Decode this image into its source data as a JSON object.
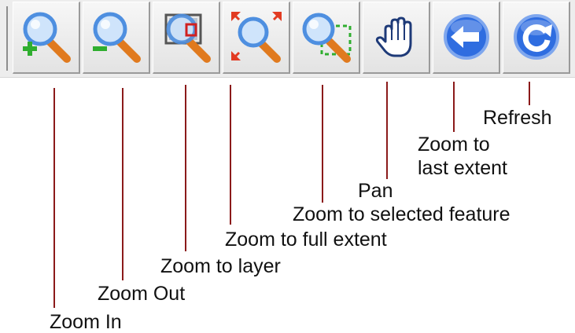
{
  "toolbar": {
    "tools": [
      {
        "icon": "zoom-in-icon",
        "label": "Zoom In"
      },
      {
        "icon": "zoom-out-icon",
        "label": "Zoom Out"
      },
      {
        "icon": "zoom-to-layer-icon",
        "label": "Zoom to layer"
      },
      {
        "icon": "zoom-full-extent-icon",
        "label": "Zoom to full extent"
      },
      {
        "icon": "zoom-selected-feature-icon",
        "label": "Zoom to selected feature"
      },
      {
        "icon": "pan-hand-icon",
        "label": "Pan"
      },
      {
        "icon": "back-arrow-icon",
        "label": "Zoom to\nlast extent"
      },
      {
        "icon": "refresh-icon",
        "label": "Refresh"
      }
    ]
  },
  "colors": {
    "callout_line": "#8b1a1a",
    "lens_blue": "#4e8fe0",
    "handle_orange": "#e07a1e",
    "plus_green": "#2fae2f",
    "arrow_red": "#e23b22",
    "button_blue": "#2f6de0"
  }
}
